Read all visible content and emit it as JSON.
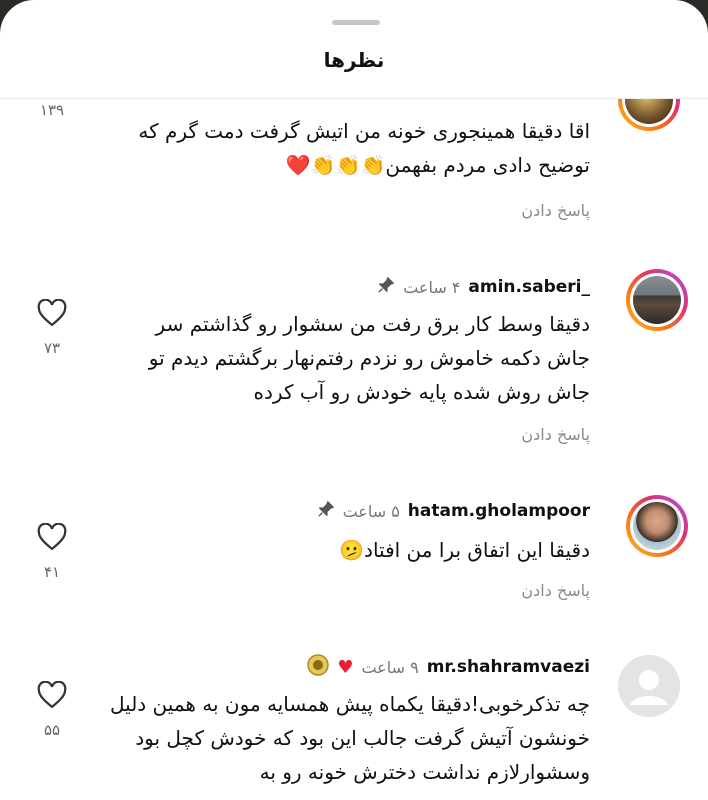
{
  "sheet": {
    "title": "نظرها"
  },
  "comments": [
    {
      "username": "",
      "time": "",
      "text": "اقا دقیقا همینجوری خونه من اتیش گرفت دمت گرم که توضیح دادی مردم بفهمن👏👏👏❤️",
      "reply_label": "پاسخ دادن",
      "like_count": "۱۳۹"
    },
    {
      "username": "amin.saberi_",
      "time": "۴ ساعت",
      "pinned": true,
      "text": "دقیقا وسط کار برق رفت من سشوار رو گذاشتم سر جاش دکمه خاموش رو نزدم رفتم‌نهار برگشتم دیدم تو جاش روش شده پایه خودش رو آب کرده",
      "reply_label": "پاسخ دادن",
      "like_count": "۷۳"
    },
    {
      "username": "hatam.gholampoor",
      "time": "۵ ساعت",
      "pinned": true,
      "text": "دقیقا این اتفاق برا من افتاد🫤",
      "reply_label": "پاسخ دادن",
      "like_count": "۴۱"
    },
    {
      "username": "mr.shahramvaezi",
      "time": "۹ ساعت",
      "creator_liked": true,
      "text": "چه تذکرخوبی!دقیقا یکماه پیش همسایه مون به همین دلیل خونشون آتیش گرفت جالب این بود که خودش کچل بود وسشوارلازم نداشت دخترش خونه رو به",
      "like_count": "۵۵"
    }
  ],
  "colors": {
    "accent_red": "#ed1c35",
    "muted": "#777777"
  },
  "icons": {
    "like": "heart-outline-icon",
    "pin": "pin-icon"
  }
}
